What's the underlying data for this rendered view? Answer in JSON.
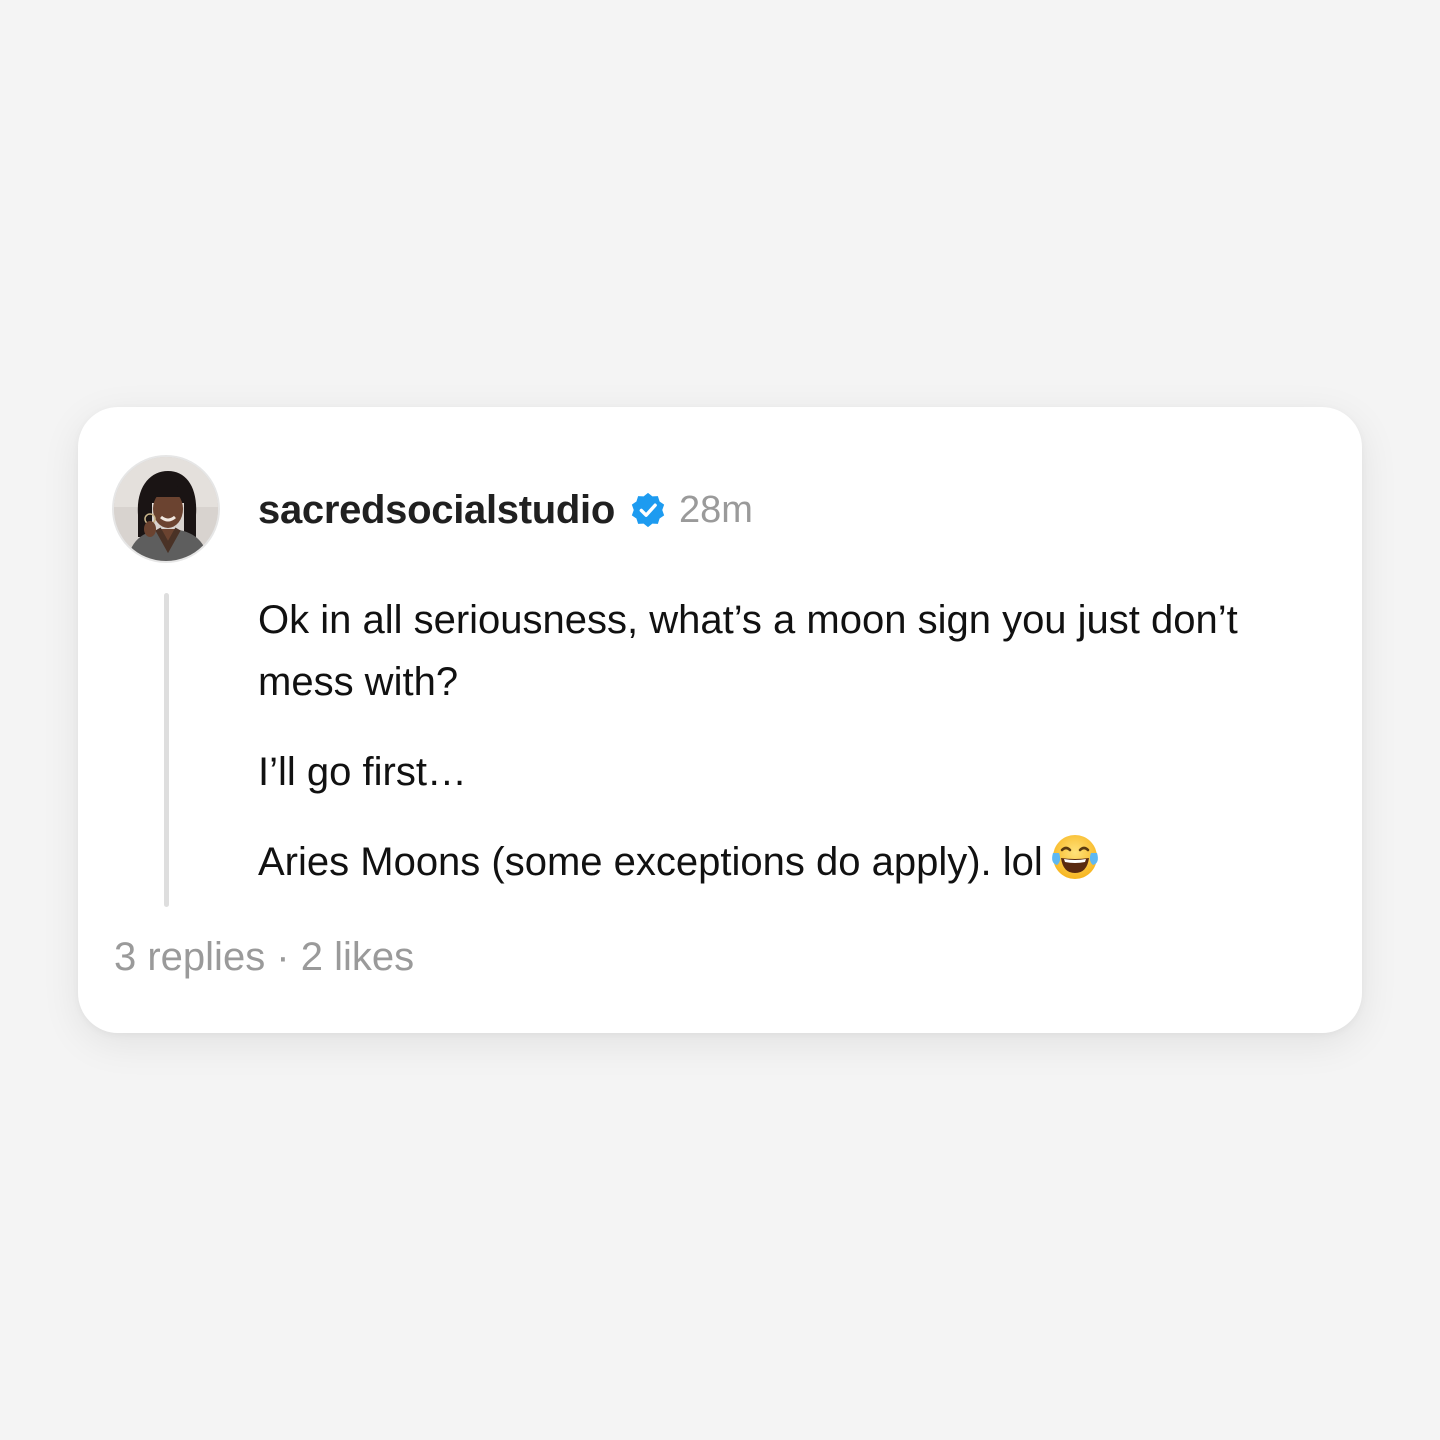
{
  "post": {
    "username": "sacredsocialstudio",
    "verified": true,
    "timestamp": "28m",
    "paragraphs": [
      "Ok in all seriousness, what’s a moon sign you just don’t mess with?",
      "I’ll go first…",
      "Aries Moons (some exceptions do apply). lol"
    ],
    "emoji": "face-with-tears-of-joy",
    "stats": "3 replies · 2 likes"
  },
  "colors": {
    "background": "#f4f4f4",
    "card": "#ffffff",
    "verified_blue": "#1d9bf0",
    "muted_text": "#9a9a9a",
    "primary_text": "#111111"
  }
}
